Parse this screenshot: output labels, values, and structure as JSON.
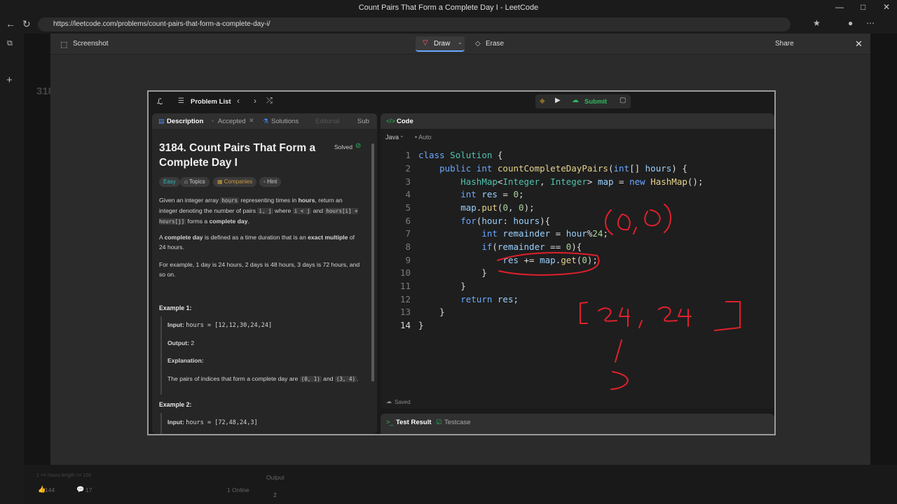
{
  "window": {
    "title": "Count Pairs That Form a Complete Day I - LeetCode",
    "url": "https://leetcode.com/problems/count-pairs-that-form-a-complete-day-i/"
  },
  "modal": {
    "title": "Screenshot",
    "draw_label": "Draw",
    "erase_label": "Erase",
    "share_label": "Share"
  },
  "leetcode": {
    "problem_list_label": "Problem List",
    "submit_label": "Submit",
    "tabs": {
      "description": "Description",
      "accepted": "Accepted",
      "solutions": "Solutions",
      "editorial": "Editorial",
      "submissions": "Sub"
    },
    "problem": {
      "title": "3184. Count Pairs That Form a Complete Day I",
      "status": "Solved",
      "difficulty": "Easy",
      "topics_label": "Topics",
      "companies_label": "Companies",
      "hint_label": "Hint",
      "p1_a": "Given an integer array",
      "p1_code1": "hours",
      "p1_b": "representing times in",
      "p1_bold": "hours",
      "p1_c": ", return an integer denoting the number of pairs",
      "p1_code2": "i, j",
      "p1_d": "where",
      "p1_code3": "i < j",
      "p1_e": "and",
      "p1_code4": "hours[i] + hours[j]",
      "p1_f": "forms a",
      "p1_bold2": "complete day",
      "p1_g": ".",
      "p2_a": "A",
      "p2_bold": "complete day",
      "p2_b": "is defined as a time duration that is an",
      "p2_bold2": "exact multiple",
      "p2_c": "of 24 hours.",
      "p3": "For example, 1 day is 24 hours, 2 days is 48 hours, 3 days is 72 hours, and so on.",
      "example1_label": "Example 1:",
      "ex1_input_label": "Input:",
      "ex1_input": "hours = [12,12,30,24,24]",
      "ex1_output_label": "Output:",
      "ex1_output": "2",
      "ex1_expl_label": "Explanation:",
      "ex1_expl_a": "The pairs of indices that form a complete day are",
      "ex1_expl_code1": "(0, 1)",
      "ex1_expl_b": "and",
      "ex1_expl_code2": "(3, 4)",
      "ex1_expl_c": ".",
      "example2_label": "Example 2:",
      "ex2_input_label": "Input:",
      "ex2_input": "hours = [72,48,24,3]"
    },
    "code_tab_label": "Code",
    "language": "Java",
    "auto_label": "Auto",
    "saved_label": "Saved",
    "test_result_label": "Test Result",
    "testcase_label": "Testcase",
    "line_numbers": [
      "1",
      "2",
      "3",
      "4",
      "5",
      "6",
      "7",
      "8",
      "9",
      "10",
      "11",
      "12",
      "13",
      "14"
    ]
  },
  "background": {
    "likes": "144",
    "comments": "17",
    "online": "1 Online",
    "output_label": "Output",
    "output_value": "2",
    "constraint": "1 <= hours.length <= 100"
  }
}
